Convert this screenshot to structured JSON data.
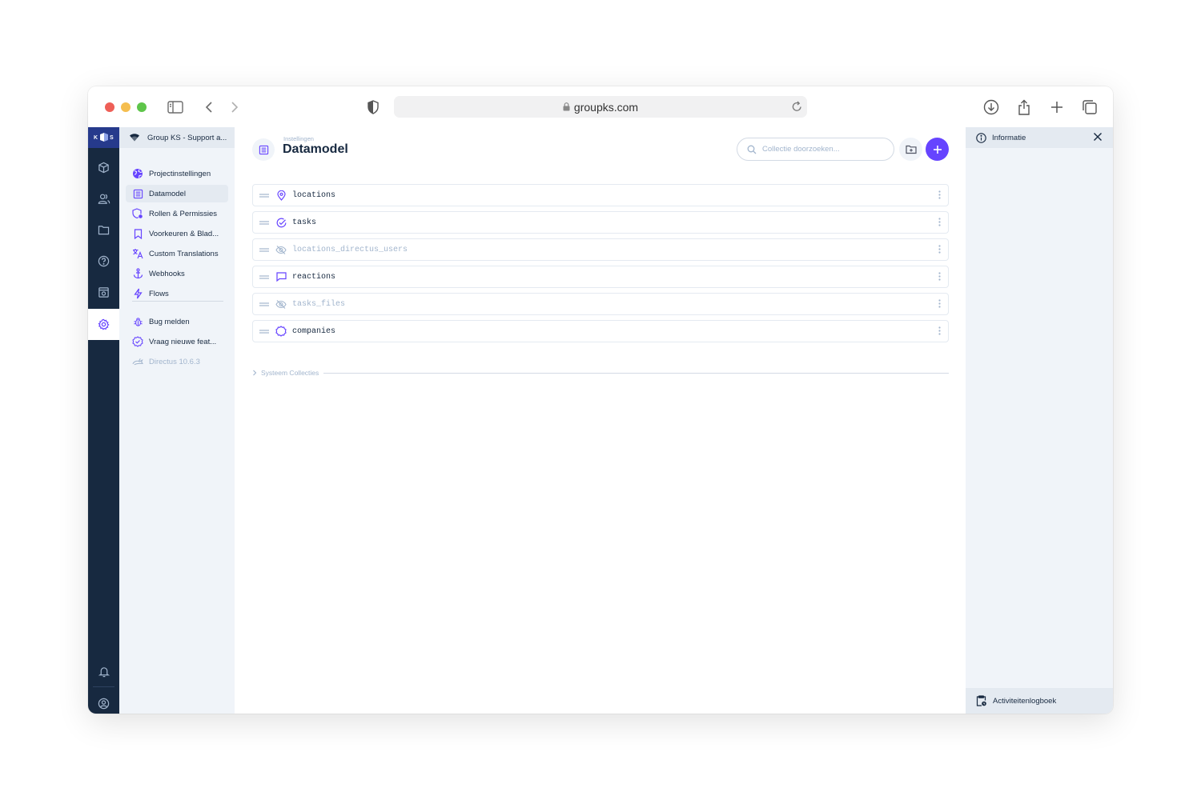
{
  "browser": {
    "url": "groupks.com"
  },
  "modules": {
    "logo_text": "K S",
    "items": [
      "content-icon",
      "users-icon",
      "files-icon",
      "help-icon",
      "insights-icon",
      "settings-icon"
    ],
    "bottom": [
      "notifications-icon",
      "account-icon"
    ]
  },
  "nav": {
    "project_name": "Group KS - Support a...",
    "items": [
      {
        "label": "Projectinstellingen",
        "icon": "globe-icon"
      },
      {
        "label": "Datamodel",
        "icon": "list-icon",
        "active": true
      },
      {
        "label": "Rollen & Permissies",
        "icon": "shield-icon"
      },
      {
        "label": "Voorkeuren & Blad...",
        "icon": "bookmark-icon"
      },
      {
        "label": "Custom Translations",
        "icon": "translate-icon"
      },
      {
        "label": "Webhooks",
        "icon": "anchor-icon"
      },
      {
        "label": "Flows",
        "icon": "bolt-icon"
      },
      {
        "label": "Bug melden",
        "icon": "bug-icon"
      },
      {
        "label": "Vraag nieuwe feat...",
        "icon": "check-badge-icon"
      },
      {
        "label": "Directus 10.6.3",
        "icon": "rabbit-icon"
      }
    ]
  },
  "header": {
    "breadcrumb": "Instellingen",
    "title": "Datamodel",
    "search_placeholder": "Collectie doorzoeken..."
  },
  "collections": [
    {
      "name": "locations",
      "icon": "pin-icon",
      "hidden": false
    },
    {
      "name": "tasks",
      "icon": "check-circle-icon",
      "hidden": false
    },
    {
      "name": "locations_directus_users",
      "icon": "eye-off-icon",
      "hidden": true
    },
    {
      "name": "reactions",
      "icon": "chat-icon",
      "hidden": false
    },
    {
      "name": "tasks_files",
      "icon": "eye-off-icon",
      "hidden": true
    },
    {
      "name": "companies",
      "icon": "badge-icon",
      "hidden": false
    }
  ],
  "system_collections_label": "Systeem Collecties",
  "sidebar": {
    "info_label": "Informatie",
    "activity_label": "Activiteitenlogboek"
  },
  "colors": {
    "accent": "#6644ff",
    "module_bar": "#172940",
    "nav_bg": "#f0f4f9"
  }
}
